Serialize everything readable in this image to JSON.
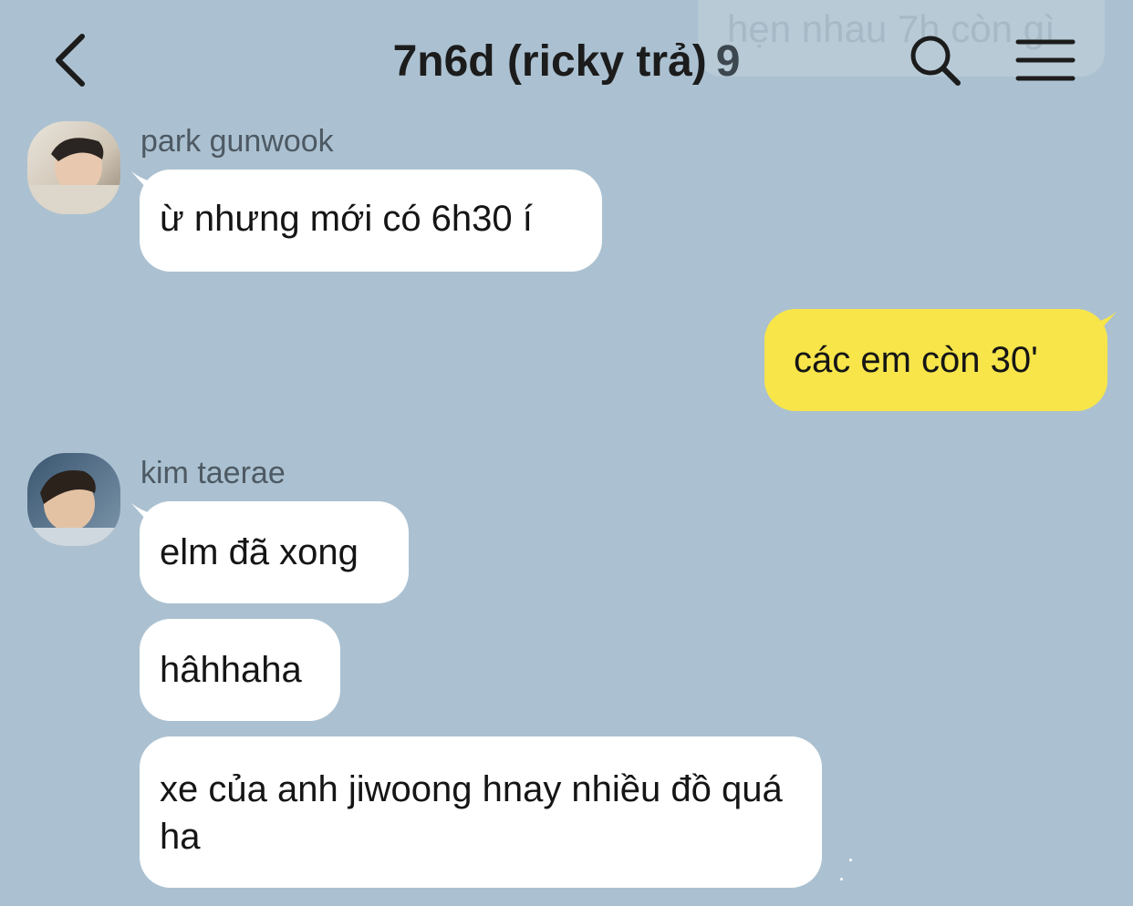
{
  "header": {
    "title": "7n6d (ricky trả)",
    "member_count": "9",
    "pinned_notice": "hẹn nhau 7h còn gì",
    "back_icon": "chevron-left-icon",
    "search_icon": "search-icon",
    "menu_icon": "hamburger-menu-icon"
  },
  "colors": {
    "background": "#abc1d1",
    "incoming_bubble": "#ffffff",
    "outgoing_bubble": "#f7e54a"
  },
  "messages": [
    {
      "sender": "park gunwook",
      "texts": [
        "ừ nhưng mới có 6h30 í"
      ]
    },
    {
      "sender": "me",
      "texts": [
        "các em còn 30'"
      ]
    },
    {
      "sender": "kim taerae",
      "texts": [
        "elm đã xong",
        "hâhhaha",
        "xe của anh jiwoong hnay nhiều đồ quá ha"
      ]
    }
  ]
}
